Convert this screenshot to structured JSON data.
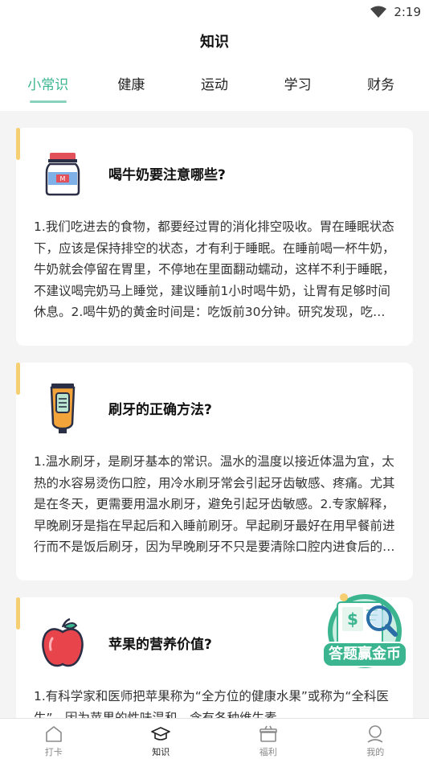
{
  "status_bar": {
    "time": "2:19"
  },
  "header": {
    "title": "知识",
    "tabs": [
      {
        "label": "小常识",
        "active": true
      },
      {
        "label": "健康"
      },
      {
        "label": "运动"
      },
      {
        "label": "学习"
      },
      {
        "label": "财务"
      }
    ]
  },
  "cards": [
    {
      "icon": "milk-bottle-icon",
      "title": "喝牛奶要注意哪些?",
      "body": "1.我们吃进去的食物，都要经过胃的消化排空吸收。胃在睡眠状态下，应该是保持排空的状态，才有利于睡眠。在睡前喝一杯牛奶，牛奶就会停留在胃里，不停地在里面翻动蠕动，这样不利于睡眠，不建议喝完奶马上睡觉，建议睡前1小时喝牛奶，让胃有足够时间休息。2.喝牛奶的黄金时间是：吃饭前30分钟。研究发现，吃同样的一餐，…"
    },
    {
      "icon": "toothpaste-icon",
      "title": "刷牙的正确方法?",
      "body": "1.温水刷牙，是刷牙基本的常识。温水的温度以接近体温为宜，太热的水容易烫伤口腔，用冷水刷牙常会引起牙齿敏感、疼痛。尤其是在冬天，更需要用温水刷牙，避免引起牙齿敏感。2.专家解释，早晚刷牙是指在早起后和入睡前刷牙。早起刷牙最好在用早餐前进行而不是饭后刷牙，因为早晚刷牙不只是要清除口腔内进食后的食物残渣，…"
    },
    {
      "icon": "apple-icon",
      "title": "苹果的营养价值?",
      "body": "1.有科学家和医师把苹果称为“全方位的健康水果”或称为“全科医生”。因为苹果的性味温和，含有各种维生素"
    }
  ],
  "float_badge": {
    "label": "答题赢金币"
  },
  "bottom_nav": [
    {
      "label": "打卡",
      "icon": "home-icon"
    },
    {
      "label": "知识",
      "icon": "graduation-cap-icon",
      "active": true
    },
    {
      "label": "福利",
      "icon": "gift-icon"
    },
    {
      "label": "我的",
      "icon": "user-icon"
    }
  ],
  "colors": {
    "accent": "#3bb58f",
    "card_bar": "#f5cf71"
  }
}
